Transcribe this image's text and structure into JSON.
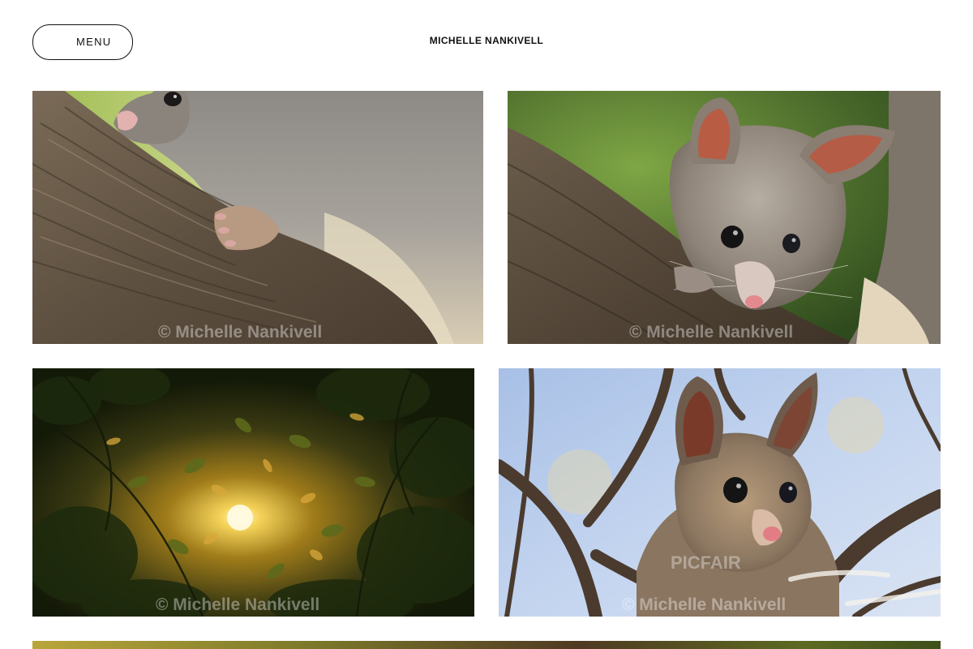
{
  "header": {
    "menu_label": "MENU",
    "site_title": "MICHELLE NANKIVELL"
  },
  "gallery": {
    "photos": [
      {
        "subject": "possum-on-branch-side",
        "watermark": "© Michelle Nankivell"
      },
      {
        "subject": "possum-portrait-on-branch",
        "watermark": "© Michelle Nankivell"
      },
      {
        "subject": "sun-through-leaves",
        "watermark": "© Michelle Nankivell"
      },
      {
        "subject": "possum-in-tree-sky",
        "watermark": "© Michelle Nankivell",
        "brand_mark": "PICFAIR"
      }
    ]
  },
  "colors": {
    "text": "#111111",
    "background": "#ffffff"
  }
}
